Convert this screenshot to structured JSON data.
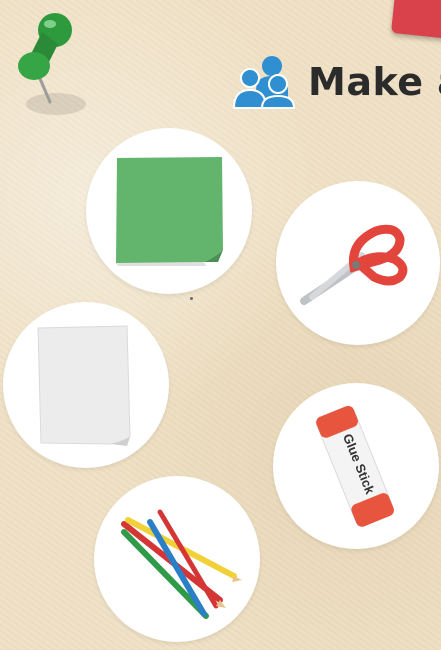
{
  "header": {
    "title": "Make a",
    "icon": "people-icon"
  },
  "supplies": [
    {
      "name": "sticky note",
      "icon": "sticky-note-icon"
    },
    {
      "name": "scissors",
      "icon": "scissors-icon"
    },
    {
      "name": "paper",
      "icon": "paper-sheet-icon"
    },
    {
      "name": "glue stick",
      "icon": "glue-stick-icon",
      "label": "Glue Stick"
    },
    {
      "name": "colored pencils",
      "icon": "colored-pencils-icon"
    }
  ],
  "colors": {
    "background": "#efe1c6",
    "accent_red": "#d9424a",
    "people_icon": "#2f8fd0",
    "pin_green": "#2e9a3e"
  }
}
